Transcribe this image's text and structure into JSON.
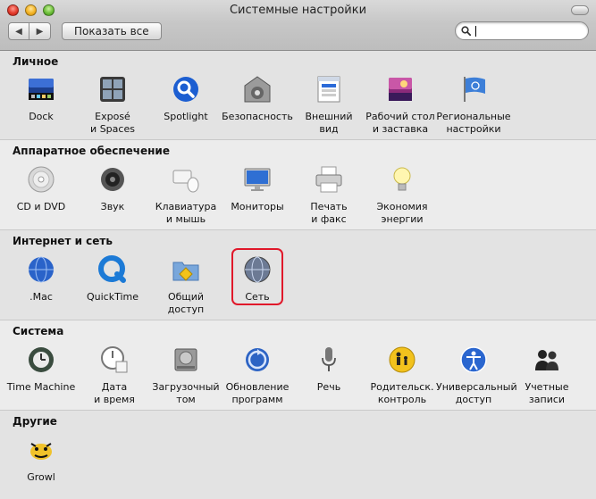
{
  "window": {
    "title": "Системные настройки"
  },
  "toolbar": {
    "back_glyph": "◀",
    "forward_glyph": "▶",
    "show_all_label": "Показать все",
    "search_value": ""
  },
  "sections": {
    "personal": {
      "title": "Личное",
      "panes": [
        {
          "label": "Dock",
          "icon": "dock-icon"
        },
        {
          "label": "Exposé\nи Spaces",
          "icon": "expose-icon"
        },
        {
          "label": "Spotlight",
          "icon": "spotlight-icon"
        },
        {
          "label": "Безопасность",
          "icon": "security-icon"
        },
        {
          "label": "Внешний\nвид",
          "icon": "appearance-icon"
        },
        {
          "label": "Рабочий стол\nи заставка",
          "icon": "desktop-icon"
        },
        {
          "label": "Региональные\nнастройки",
          "icon": "international-icon"
        }
      ]
    },
    "hardware": {
      "title": "Аппаратное обеспечение",
      "panes": [
        {
          "label": "CD и DVD",
          "icon": "cd-dvd-icon"
        },
        {
          "label": "Звук",
          "icon": "sound-icon"
        },
        {
          "label": "Клавиатура\nи мышь",
          "icon": "keyboard-mouse-icon"
        },
        {
          "label": "Мониторы",
          "icon": "displays-icon"
        },
        {
          "label": "Печать\nи факс",
          "icon": "print-fax-icon"
        },
        {
          "label": "Экономия\nэнергии",
          "icon": "energy-saver-icon"
        }
      ]
    },
    "internet": {
      "title": "Интернет и сеть",
      "panes": [
        {
          "label": ".Mac",
          "icon": "dotmac-icon"
        },
        {
          "label": "QuickTime",
          "icon": "quicktime-icon"
        },
        {
          "label": "Общий\nдоступ",
          "icon": "sharing-icon"
        },
        {
          "label": "Сеть",
          "icon": "network-icon"
        }
      ]
    },
    "system": {
      "title": "Система",
      "panes": [
        {
          "label": "Time Machine",
          "icon": "time-machine-icon"
        },
        {
          "label": "Дата\nи время",
          "icon": "date-time-icon"
        },
        {
          "label": "Загрузочный\nтом",
          "icon": "startup-disk-icon"
        },
        {
          "label": "Обновление\nпрограмм",
          "icon": "software-update-icon"
        },
        {
          "label": "Речь",
          "icon": "speech-icon"
        },
        {
          "label": "Родительск.\nконтроль",
          "icon": "parental-controls-icon"
        },
        {
          "label": "Универсальный\nдоступ",
          "icon": "universal-access-icon"
        },
        {
          "label": "Учетные\nзаписи",
          "icon": "accounts-icon"
        }
      ]
    },
    "other": {
      "title": "Другие",
      "panes": [
        {
          "label": "Growl",
          "icon": "growl-icon"
        }
      ]
    }
  },
  "highlight_color": "#e0182a"
}
